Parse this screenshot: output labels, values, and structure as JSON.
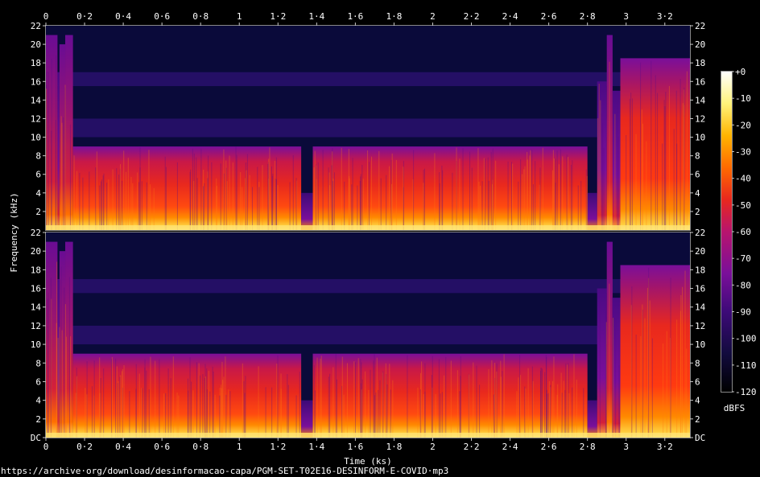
{
  "chart_data": {
    "type": "heatmap",
    "xlabel": "Time (ks)",
    "ylabel": "Frequency (kHz)",
    "x_range": [
      0,
      3.33
    ],
    "y_range_khz": [
      0,
      22
    ],
    "x_ticks": [
      "0",
      "0·2",
      "0·4",
      "0·6",
      "0·8",
      "1",
      "1·2",
      "1·4",
      "1·6",
      "1·8",
      "2",
      "2·2",
      "2·4",
      "2·6",
      "2·8",
      "3",
      "3·2"
    ],
    "x_tick_values": [
      0,
      0.2,
      0.4,
      0.6,
      0.8,
      1.0,
      1.2,
      1.4,
      1.6,
      1.8,
      2.0,
      2.2,
      2.4,
      2.6,
      2.8,
      3.0,
      3.2
    ],
    "y_ticks_top": [
      "22",
      "20",
      "18",
      "16",
      "14",
      "12",
      "10",
      "8",
      "6",
      "4",
      "2"
    ],
    "y_ticks_bottom": [
      "22",
      "20",
      "18",
      "16",
      "14",
      "12",
      "10",
      "8",
      "6",
      "4",
      "2",
      "DC"
    ],
    "y_tick_values": [
      22,
      20,
      18,
      16,
      14,
      12,
      10,
      8,
      6,
      4,
      2,
      0
    ],
    "channels": [
      "left",
      "right"
    ],
    "colorbar": {
      "label": "dBFS",
      "ticks": [
        "+0",
        "-10",
        "-20",
        "-30",
        "-40",
        "-50",
        "-60",
        "-70",
        "-80",
        "-90",
        "-100",
        "-110",
        "-120"
      ],
      "tick_values": [
        0,
        -10,
        -20,
        -30,
        -40,
        -50,
        -60,
        -70,
        -80,
        -90,
        -100,
        -110,
        -120
      ],
      "range": [
        -120,
        0
      ],
      "colormap": "inferno-like",
      "colors": [
        "#000000",
        "#120b3e",
        "#3d0a78",
        "#7a0f9a",
        "#b8146e",
        "#e8281e",
        "#ff6a00",
        "#ffb400",
        "#fff37a",
        "#ffffff"
      ]
    },
    "segments": [
      {
        "t_start": 0.0,
        "t_end": 0.06,
        "content_top_khz": 21,
        "level": "loud"
      },
      {
        "t_start": 0.06,
        "t_end": 0.07,
        "content_top_khz": 17,
        "level": "moderate"
      },
      {
        "t_start": 0.07,
        "t_end": 0.1,
        "content_top_khz": 20,
        "level": "loud"
      },
      {
        "t_start": 0.1,
        "t_end": 0.14,
        "content_top_khz": 21,
        "level": "loud"
      },
      {
        "t_start": 0.14,
        "t_end": 1.32,
        "content_top_khz": 9,
        "level": "speech"
      },
      {
        "t_start": 1.32,
        "t_end": 1.38,
        "content_top_khz": 4,
        "level": "quiet"
      },
      {
        "t_start": 1.38,
        "t_end": 2.8,
        "content_top_khz": 9,
        "level": "speech"
      },
      {
        "t_start": 2.8,
        "t_end": 2.85,
        "content_top_khz": 4,
        "level": "quiet"
      },
      {
        "t_start": 2.85,
        "t_end": 2.9,
        "content_top_khz": 16,
        "level": "moderate"
      },
      {
        "t_start": 2.9,
        "t_end": 2.93,
        "content_top_khz": 21,
        "level": "loud"
      },
      {
        "t_start": 2.93,
        "t_end": 2.97,
        "content_top_khz": 15,
        "level": "moderate"
      },
      {
        "t_start": 2.97,
        "t_end": 3.33,
        "content_top_khz": 18.5,
        "level": "music"
      }
    ],
    "background_bands_khz": [
      {
        "low": 10,
        "high": 12,
        "level": "faint"
      },
      {
        "low": 15.5,
        "high": 17,
        "level": "faint"
      }
    ]
  },
  "footer": {
    "url": "https://archive·org/download/desinformacao-capa/PGM-SET-T02E16-DESINFORM-E-COVID·mp3"
  }
}
